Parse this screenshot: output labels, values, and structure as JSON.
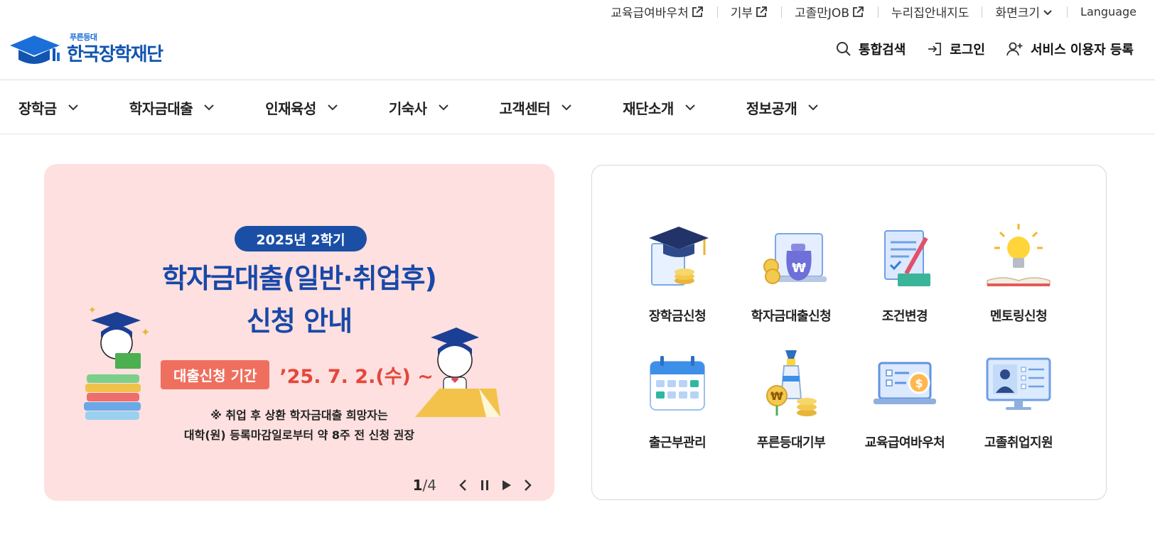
{
  "utility": {
    "links": [
      {
        "label": "교육급여바우처",
        "external": true
      },
      {
        "label": "기부",
        "external": true
      },
      {
        "label": "고졸만JOB",
        "external": true
      },
      {
        "label": "누리집안내지도",
        "external": false
      }
    ],
    "screen_size": "화면크기",
    "language": "Language"
  },
  "header": {
    "logo_sub": "푸른등대",
    "logo_name": "한국장학재단",
    "search": "통합검색",
    "login": "로그인",
    "register": "서비스 이용자 등록"
  },
  "gnb": [
    "장학금",
    "학자금대출",
    "인재육성",
    "기숙사",
    "고객센터",
    "재단소개",
    "정보공개"
  ],
  "banner": {
    "badge": "2025년 2학기",
    "title_line1": "학자금대출(일반·취업후)",
    "title_line2": "신청 안내",
    "period_label": "대출신청 기간",
    "period_date": "’25. 7. 2.(수) ~",
    "note_line1": "※ 취업 후 상환 학자금대출 희망자는",
    "note_line2": "대학(원) 등록마감일로부터 약 8주 전 신청 권장",
    "page_current": "1",
    "page_total": "/4"
  },
  "quick_menu": [
    {
      "label": "장학금신청",
      "icon": "graduation-cap-icon"
    },
    {
      "label": "학자금대출신청",
      "icon": "money-bag-icon"
    },
    {
      "label": "조건변경",
      "icon": "document-pen-icon"
    },
    {
      "label": "멘토링신청",
      "icon": "lightbulb-book-icon"
    },
    {
      "label": "출근부관리",
      "icon": "calendar-icon"
    },
    {
      "label": "푸른등대기부",
      "icon": "lighthouse-icon"
    },
    {
      "label": "교육급여바우처",
      "icon": "laptop-voucher-icon"
    },
    {
      "label": "고졸취업지원",
      "icon": "monitor-profile-icon"
    }
  ],
  "colors": {
    "brand_blue": "#1255b0",
    "banner_bg": "#fde0df",
    "banner_title": "#1848a8",
    "accent_red": "#e4473a"
  }
}
